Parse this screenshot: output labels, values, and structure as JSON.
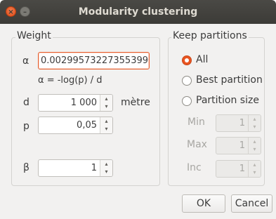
{
  "window": {
    "title": "Modularity clustering",
    "close_glyph": "×",
    "min_glyph": "–"
  },
  "weight": {
    "legend": "Weight",
    "alpha_label": "α",
    "alpha_value": "0.002995732273553990",
    "formula": "α = -log(p) / d",
    "d_label": "d",
    "d_value": "1 000",
    "d_unit": "mètre",
    "p_label": "p",
    "p_value": "0,05",
    "beta_label": "β",
    "beta_value": "1"
  },
  "partitions": {
    "legend": "Keep partitions",
    "options": [
      "All",
      "Best partition",
      "Partition size"
    ],
    "selected": "All",
    "min_label": "Min",
    "min_value": "1",
    "max_label": "Max",
    "max_value": "1",
    "inc_label": "Inc",
    "inc_value": "1"
  },
  "buttons": {
    "ok": "OK",
    "cancel": "Cancel"
  },
  "icons": {
    "spin_up": "▴",
    "spin_down": "▾"
  },
  "colors": {
    "accent": "#e95420",
    "titlebar": "#3c3b37"
  }
}
